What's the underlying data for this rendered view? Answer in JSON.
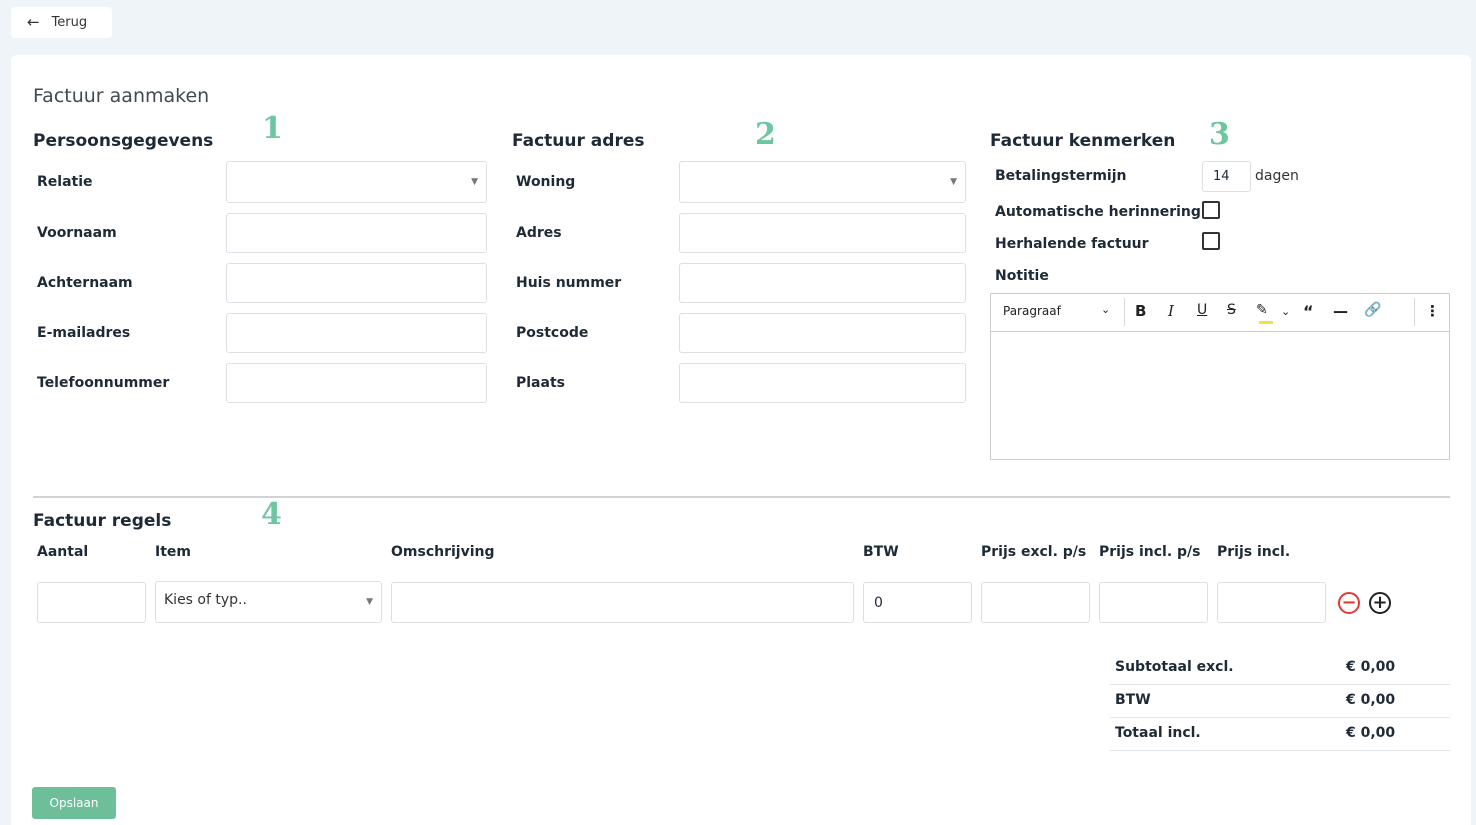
{
  "header": {
    "back_label": "Terug"
  },
  "page_title": "Factuur aanmaken",
  "persons": {
    "title": "Persoonsgegevens",
    "step": "1",
    "fields": [
      {
        "label": "Relatie"
      },
      {
        "label": "Voornaam"
      },
      {
        "label": "Achternaam"
      },
      {
        "label": "E-mailadres"
      },
      {
        "label": "Telefoonnummer"
      }
    ]
  },
  "address": {
    "title": "Factuur adres",
    "step": "2",
    "fields": [
      {
        "label": "Woning"
      },
      {
        "label": "Adres"
      },
      {
        "label": "Huis nummer"
      },
      {
        "label": "Postcode"
      },
      {
        "label": "Plaats"
      }
    ]
  },
  "props": {
    "title": "Factuur kenmerken",
    "step": "3",
    "payment_term_label": "Betalingstermijn",
    "payment_term_value": "14",
    "payment_term_unit": "dagen",
    "reminder_label": "Automatische herinnering",
    "recurring_label": "Herhalende factuur",
    "note_label": "Notitie",
    "editor": {
      "paragraph_label": "Paragraaf"
    }
  },
  "lines": {
    "title": "Factuur regels",
    "step": "4",
    "columns": [
      "Aantal",
      "Item",
      "Omschrijving",
      "BTW",
      "Prijs excl. p/s",
      "Prijs incl. p/s",
      "Prijs incl."
    ],
    "item_placeholder": "Kies of typ..",
    "btw_value": "0"
  },
  "summary": [
    {
      "label": "Subtotaal excl.",
      "value": "€ 0,00"
    },
    {
      "label": "BTW",
      "value": "€ 0,00"
    },
    {
      "label": "Totaal incl.",
      "value": "€ 0,00"
    }
  ],
  "save_label": "Opslaan",
  "colors": {
    "accent": "#6cc6a0",
    "save": "#6cbf98",
    "remove": "#e53935"
  }
}
